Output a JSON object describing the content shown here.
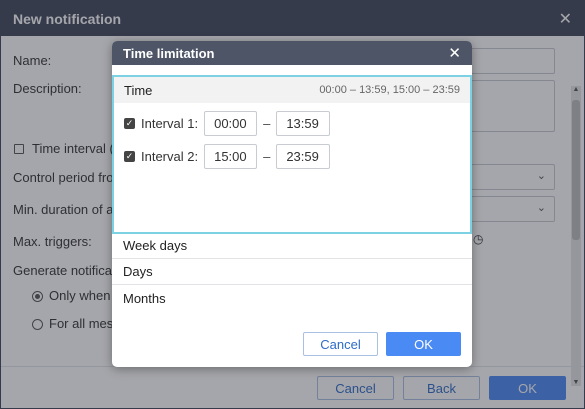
{
  "background_dialog": {
    "title": "New notification",
    "name_label": "Name:",
    "description_label": "Description:",
    "time_interval_label": "Time interval (",
    "control_period_label": "Control period fro",
    "min_duration_label": "Min. duration of a",
    "max_triggers_label": "Max. triggers:",
    "generate_label": "Generate notificati",
    "radio_only_label": "Only when s",
    "radio_all_label": "For all mess",
    "cancel_label": "Cancel",
    "back_label": "Back",
    "ok_label": "OK"
  },
  "modal": {
    "title": "Time limitation",
    "time_section": {
      "title": "Time",
      "summary": "00:00 – 13:59, 15:00 – 23:59",
      "intervals": [
        {
          "label": "Interval 1:",
          "checked": true,
          "from": "00:00",
          "to": "13:59"
        },
        {
          "label": "Interval 2:",
          "checked": true,
          "from": "15:00",
          "to": "23:59"
        }
      ],
      "dash": "–"
    },
    "sections": [
      "Week days",
      "Days",
      "Months"
    ],
    "cancel_label": "Cancel",
    "ok_label": "OK"
  },
  "colors": {
    "header_bg": "#41485a",
    "modal_header_bg": "#4d5567",
    "accent": "#4a8af4",
    "focus_border": "#7cd2e3"
  },
  "icons": [
    "close-icon",
    "chevron-down-icon",
    "checkbox-checked-icon",
    "clock-icon"
  ]
}
